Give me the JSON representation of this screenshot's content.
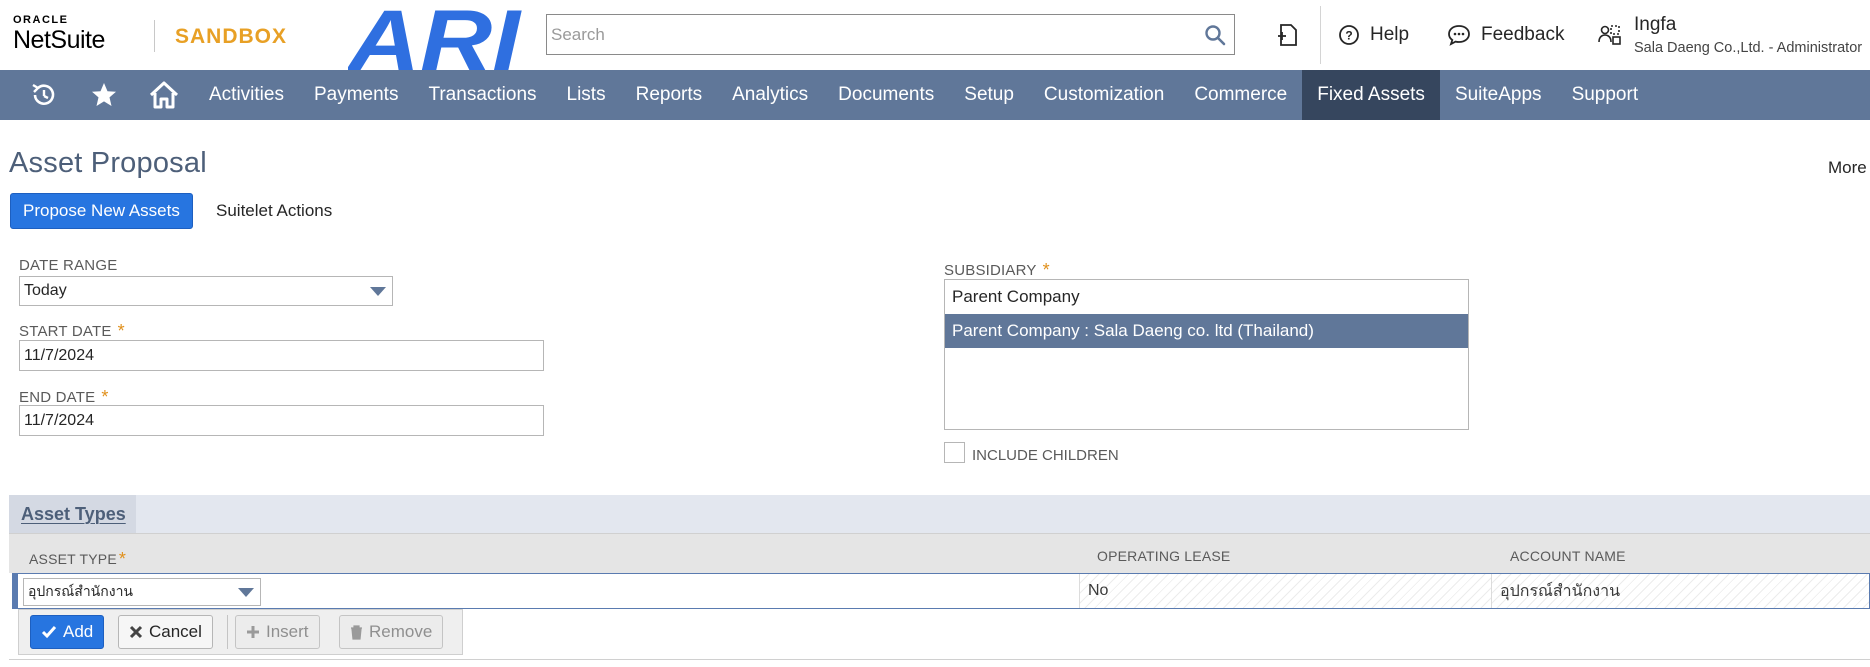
{
  "header": {
    "oracle": "ORACLE",
    "netsuite": "NetSuite",
    "sandbox": "SANDBOX",
    "ari_logo": "ARI",
    "search_placeholder": "Search",
    "help": "Help",
    "feedback": "Feedback",
    "user_name": "Ingfa",
    "user_role": "Sala Daeng Co.,Ltd. - Administrator",
    "brand_color": "#e8a025",
    "ari_color": "#2f6fe0"
  },
  "nav": {
    "icons": [
      "recent-records-icon",
      "star-icon",
      "home-icon"
    ],
    "items": [
      "Activities",
      "Payments",
      "Transactions",
      "Lists",
      "Reports",
      "Analytics",
      "Documents",
      "Setup",
      "Customization",
      "Commerce",
      "Fixed Assets",
      "SuiteApps",
      "Support"
    ],
    "active": "Fixed Assets",
    "bg_color": "#607799",
    "active_color": "#36465e"
  },
  "page": {
    "title": "Asset Proposal",
    "more": "More",
    "propose_button": "Propose New Assets",
    "suitelet_actions": "Suitelet Actions"
  },
  "form": {
    "date_range_label": "DATE RANGE",
    "date_range_value": "Today",
    "start_date_label": "START DATE",
    "start_date_value": "11/7/2024",
    "end_date_label": "END DATE",
    "end_date_value": "11/7/2024",
    "required_mark": "*",
    "subsidiary_label": "SUBSIDIARY",
    "subsidiary_options": [
      "Parent Company",
      "Parent Company : Sala Daeng co. ltd (Thailand)"
    ],
    "subsidiary_selected_index": 1,
    "include_children_label": "INCLUDE CHILDREN",
    "include_children_checked": false
  },
  "sublist": {
    "tab_label": "Asset Types",
    "columns": [
      "ASSET TYPE",
      "OPERATING LEASE",
      "ACCOUNT NAME"
    ],
    "edit_row": {
      "asset_type": "อุปกรณ์สำนักงาน",
      "operating_lease": "No",
      "account_name": "อุปกรณ์สำนักงาน"
    },
    "buttons": {
      "add": "Add",
      "cancel": "Cancel",
      "insert": "Insert",
      "remove": "Remove"
    }
  }
}
